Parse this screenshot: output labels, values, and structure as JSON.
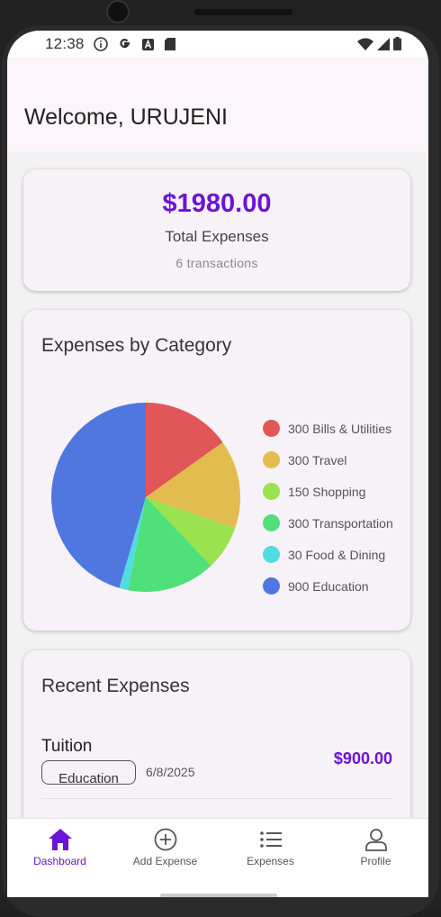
{
  "status_bar": {
    "time": "12:38",
    "icons": [
      "info-icon",
      "google-icon",
      "a-icon",
      "sd-card-icon"
    ],
    "right_icons": [
      "wifi-icon",
      "signal-icon",
      "battery-icon"
    ]
  },
  "header": {
    "welcome": "Welcome, URUJENI"
  },
  "summary": {
    "amount": "$1980.00",
    "label": "Total Expenses",
    "transactions": "6 transactions"
  },
  "category_card": {
    "title": "Expenses by Category"
  },
  "chart_data": {
    "type": "pie",
    "title": "Expenses by Category",
    "categories": [
      "Bills & Utilities",
      "Travel",
      "Shopping",
      "Transportation",
      "Food & Dining",
      "Education"
    ],
    "values": [
      300,
      300,
      150,
      300,
      30,
      900
    ],
    "colors": [
      "#e15656",
      "#e3bc50",
      "#9ae250",
      "#50e07a",
      "#50dde2",
      "#5077e0"
    ],
    "legend_labels": [
      "300 Bills & Utilities",
      "300 Travel",
      "150 Shopping",
      "300 Transportation",
      "30 Food & Dining",
      "900 Education"
    ],
    "legend_position": "right"
  },
  "recent": {
    "title": "Recent Expenses",
    "items": [
      {
        "name": "Tuition",
        "category": "Education",
        "date": "6/8/2025",
        "amount": "$900.00"
      }
    ]
  },
  "nav": {
    "items": [
      {
        "label": "Dashboard",
        "icon": "home-icon",
        "active": true
      },
      {
        "label": "Add Expense",
        "icon": "add-circle-icon"
      },
      {
        "label": "Expenses",
        "icon": "list-icon"
      },
      {
        "label": "Profile",
        "icon": "person-icon"
      }
    ],
    "accent": "#6a14d8"
  }
}
